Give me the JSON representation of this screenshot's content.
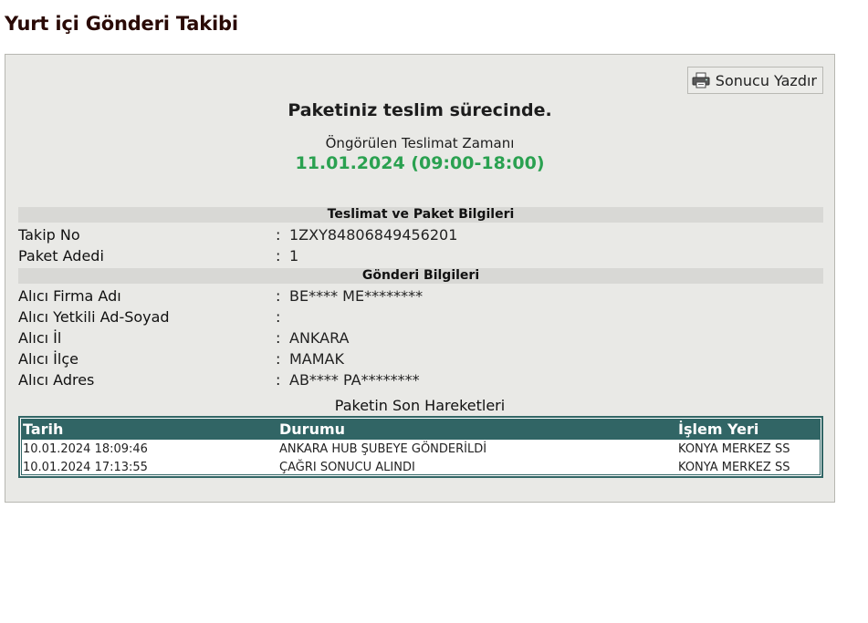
{
  "page": {
    "title": "Yurt içi Gönderi Takibi"
  },
  "toolbar": {
    "print_label": "Sonucu Yazdır",
    "print_icon": "printer-icon"
  },
  "status": {
    "message": "Paketiniz teslim sürecinde.",
    "eta_label": "Öngörülen Teslimat Zamanı",
    "eta_value": "11.01.2024 (09:00-18:00)",
    "eta_color": "#2aa150"
  },
  "sections": {
    "package": {
      "title": "Teslimat ve Paket Bilgileri",
      "rows": [
        {
          "label": "Takip No",
          "value": "1ZXY84806849456201"
        },
        {
          "label": "Paket Adedi",
          "value": "1"
        }
      ]
    },
    "shipment": {
      "title": "Gönderi Bilgileri",
      "rows": [
        {
          "label": "Alıcı Firma Adı",
          "value": "BE**** ME********"
        },
        {
          "label": "Alıcı Yetkili Ad-Soyad",
          "value": ""
        },
        {
          "label": "Alıcı İl",
          "value": "ANKARA"
        },
        {
          "label": "Alıcı İlçe",
          "value": "MAMAK"
        },
        {
          "label": "Alıcı Adres",
          "value": "AB**** PA********"
        }
      ]
    }
  },
  "history": {
    "title": "Paketin Son Hareketleri",
    "header_color": "#316565",
    "columns": [
      "Tarih",
      "Durumu",
      "İşlem Yeri"
    ],
    "rows": [
      [
        "10.01.2024 18:09:46",
        "ANKARA HUB ŞUBEYE GÖNDERİLDİ",
        "KONYA MERKEZ SS"
      ],
      [
        "10.01.2024 17:13:55",
        "ÇAĞRI SONUCU ALINDI",
        "KONYA MERKEZ SS"
      ]
    ]
  }
}
